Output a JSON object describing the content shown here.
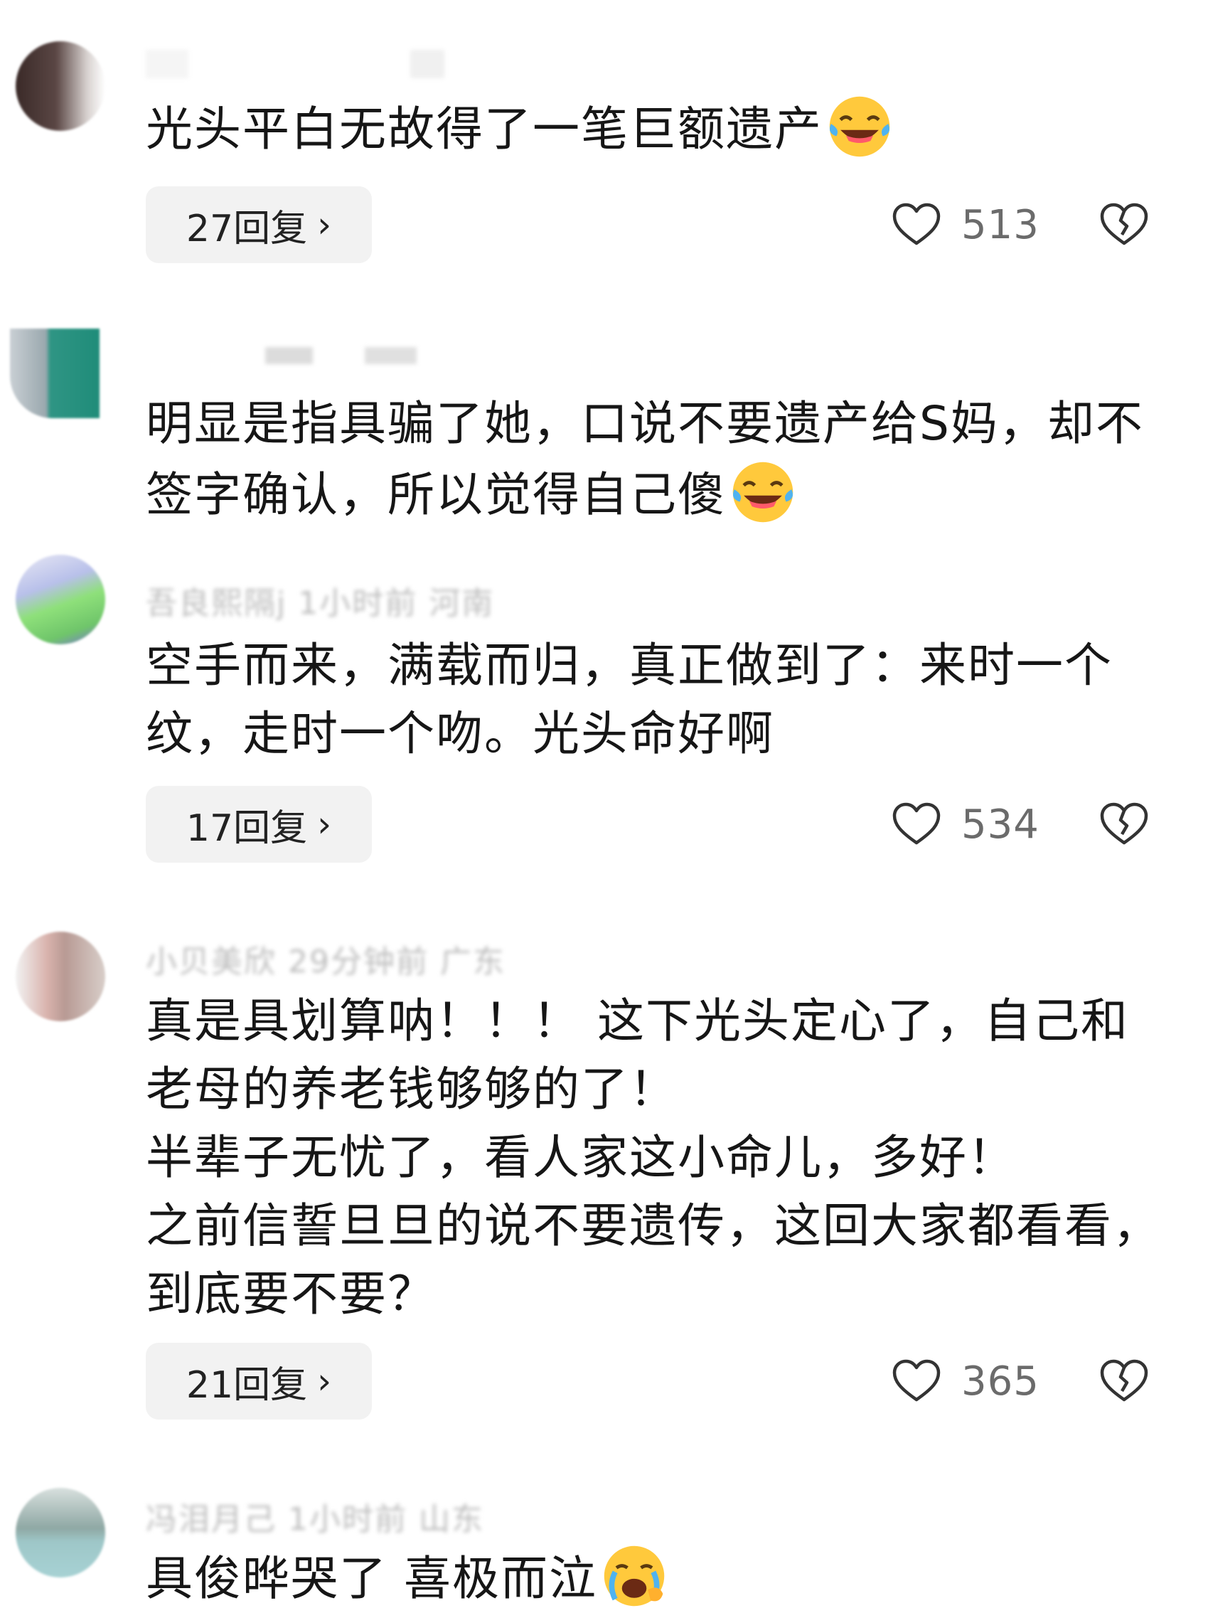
{
  "comments": [
    {
      "text": "光头平白无故得了一笔巨额遗产",
      "emoji": "tears-of-joy",
      "replies": "27回复",
      "likes": "513"
    },
    {
      "text": "明显是指具骗了她，口说不要遗产给S妈，却不签字确认，所以觉得自己傻",
      "emoji": "tears-of-joy"
    },
    {
      "meta": "吾良熙隔j  1小时前  河南",
      "text": "空手而来，满载而归，真正做到了：来时一个纹，走时一个吻。光头命好啊",
      "replies": "17回复",
      "likes": "534"
    },
    {
      "meta": "小贝美欣  29分钟前  广东",
      "text": "真是具划算呐！！！ 这下光头定心了，自己和老母的养老钱够够的了！\n半辈子无忧了，看人家这小命儿，多好！\n之前信誓旦旦的说不要遗传，这回大家都看看，到底要不要？",
      "replies": "21回复",
      "likes": "365"
    },
    {
      "meta": "冯泪月己  1小时前  山东",
      "text": "具俊晔哭了 喜极而泣",
      "emoji": "loudly-crying"
    }
  ],
  "icons": {
    "like": "heart-icon",
    "dislike": "broken-heart-icon",
    "reply_arrow": "chevron-right-icon"
  },
  "colors": {
    "reply_bg": "#f2f2f2",
    "count_text": "#6b6b6b",
    "emoji_yellow": "#ffc93c"
  }
}
